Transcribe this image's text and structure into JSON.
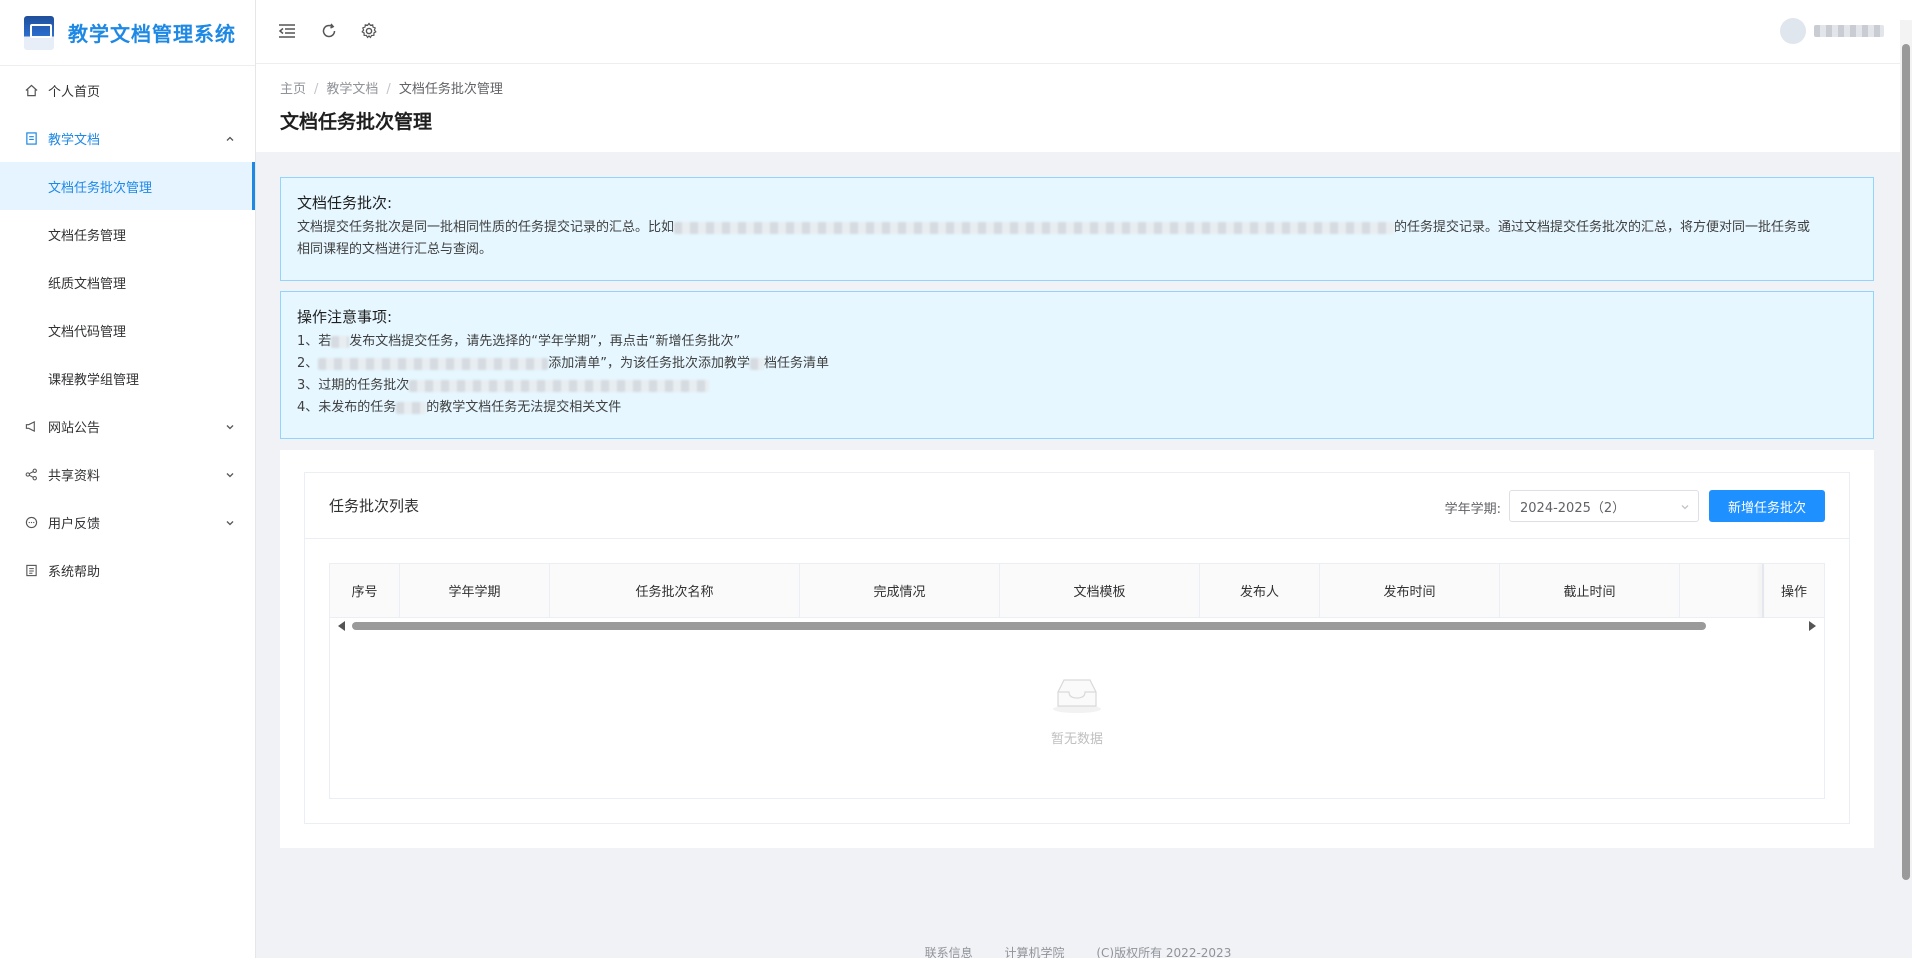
{
  "app": {
    "title": "教学文档管理系统"
  },
  "sidebar": {
    "items": [
      {
        "label": "个人首页",
        "icon": "home-icon"
      },
      {
        "label": "教学文档",
        "icon": "document-icon",
        "open": true,
        "children": [
          {
            "label": "文档任务批次管理",
            "active": true
          },
          {
            "label": "文档任务管理"
          },
          {
            "label": "纸质文档管理"
          },
          {
            "label": "文档代码管理"
          },
          {
            "label": "课程教学组管理"
          }
        ]
      },
      {
        "label": "网站公告",
        "icon": "megaphone-icon"
      },
      {
        "label": "共享资料",
        "icon": "share-icon"
      },
      {
        "label": "用户反馈",
        "icon": "chat-icon"
      },
      {
        "label": "系统帮助",
        "icon": "help-book-icon"
      }
    ]
  },
  "breadcrumb": [
    "主页",
    "教学文档",
    "文档任务批次管理"
  ],
  "page_title": "文档任务批次管理",
  "info1": {
    "title": "文档任务批次:",
    "text_a": "文档提交任务批次是同一批相同性质的任务提交记录的汇总。比如",
    "text_b": "的任务提交记录。通过文档提交任务批次的汇总，将方便对同一批任务或",
    "text_c": "相同课程的文档进行汇总与查阅。"
  },
  "info2": {
    "title": "操作注意事项:",
    "line1_a": "1、若",
    "line1_b": "发布文档提交任务，请先选择的“学年学期”，再点击“新增任务批次”",
    "line2_a": "2、",
    "line2_b": "添加清单”，为该任务批次添加教学",
    "line2_c": "档任务清单",
    "line3_a": "3、过期的任务批次",
    "line4_a": "4、未发布的任务",
    "line4_b": "的教学文档任务无法提交相关文件"
  },
  "card": {
    "title": "任务批次列表",
    "term_label": "学年学期:",
    "term_value": "2024-2025（2）",
    "add_button": "新增任务批次"
  },
  "table": {
    "columns": [
      "序号",
      "学年学期",
      "任务批次名称",
      "完成情况",
      "文档模板",
      "发布人",
      "发布时间",
      "截止时间",
      "",
      "操作"
    ],
    "rows": [],
    "empty_text": "暂无数据"
  },
  "footer": [
    "联系信息",
    "计算机学院",
    "(C)版权所有 2022-2023"
  ],
  "colors": {
    "accent": "#1e88e5",
    "info_bg": "#e6f7ff",
    "info_border": "#91d5ff",
    "button": "#1e90ff"
  }
}
